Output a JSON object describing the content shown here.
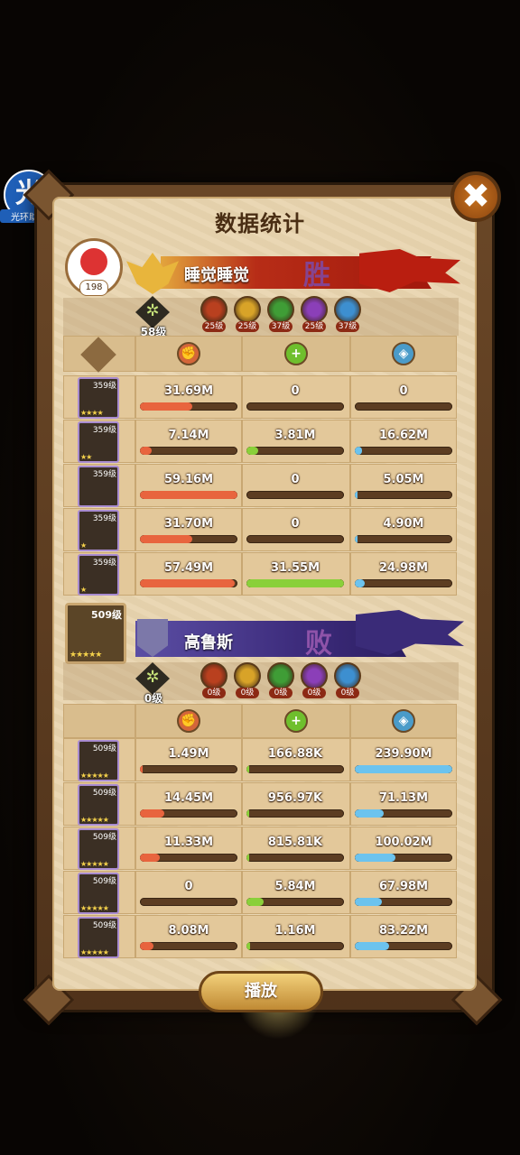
{
  "watermark": {
    "char": "光",
    "caption": "光环助手"
  },
  "title": "数据统计",
  "close_label": "✖",
  "player1": {
    "name": "睡觉睡觉",
    "result": "胜",
    "avatar_level": "198",
    "tree_level": "58级",
    "faction_levels": [
      "25级",
      "25级",
      "37级",
      "25级",
      "37级"
    ],
    "heroes": [
      {
        "level": "359级",
        "stars": "★★★★",
        "damage": "31.69M",
        "healing": "0",
        "shield": "0",
        "damage_pct": 0.54,
        "healing_pct": 0,
        "shield_pct": 0
      },
      {
        "level": "359级",
        "stars": "★★",
        "damage": "7.14M",
        "healing": "3.81M",
        "shield": "16.62M",
        "damage_pct": 0.12,
        "healing_pct": 0.12,
        "shield_pct": 0.07
      },
      {
        "level": "359级",
        "stars": "",
        "damage": "59.16M",
        "healing": "0",
        "shield": "5.05M",
        "damage_pct": 1.0,
        "healing_pct": 0,
        "shield_pct": 0.02
      },
      {
        "level": "359级",
        "stars": "★",
        "damage": "31.70M",
        "healing": "0",
        "shield": "4.90M",
        "damage_pct": 0.54,
        "healing_pct": 0,
        "shield_pct": 0.02
      },
      {
        "level": "359级",
        "stars": "★",
        "damage": "57.49M",
        "healing": "31.55M",
        "shield": "24.98M",
        "damage_pct": 0.97,
        "healing_pct": 1.0,
        "shield_pct": 0.1
      }
    ]
  },
  "player2": {
    "name": "高鲁斯",
    "result": "败",
    "avatar_level": "509级",
    "avatar_stars": "★★★★★",
    "tree_level": "0级",
    "faction_levels": [
      "0级",
      "0级",
      "0级",
      "0级",
      "0级"
    ],
    "heroes": [
      {
        "level": "509级",
        "stars": "★★★★★",
        "damage": "1.49M",
        "healing": "166.88K",
        "shield": "239.90M",
        "damage_pct": 0.03,
        "healing_pct": 0.02,
        "shield_pct": 1.0
      },
      {
        "level": "509级",
        "stars": "★★★★★",
        "damage": "14.45M",
        "healing": "956.97K",
        "shield": "71.13M",
        "damage_pct": 0.25,
        "healing_pct": 0.02,
        "shield_pct": 0.3
      },
      {
        "level": "509级",
        "stars": "★★★★★",
        "damage": "11.33M",
        "healing": "815.81K",
        "shield": "100.02M",
        "damage_pct": 0.2,
        "healing_pct": 0.02,
        "shield_pct": 0.42
      },
      {
        "level": "509级",
        "stars": "★★★★★",
        "damage": "0",
        "healing": "5.84M",
        "shield": "67.98M",
        "damage_pct": 0,
        "healing_pct": 0.18,
        "shield_pct": 0.28
      },
      {
        "level": "509级",
        "stars": "★★★★★",
        "damage": "8.08M",
        "healing": "1.16M",
        "shield": "83.22M",
        "damage_pct": 0.14,
        "healing_pct": 0.04,
        "shield_pct": 0.35
      }
    ]
  },
  "colors": {
    "damage": "#e8643e",
    "healing": "#8ad03a",
    "shield": "#6cc3ee"
  },
  "factions": [
    "#b9401f",
    "#d8a328",
    "#3f9d36",
    "#8b3fb8",
    "#3d8fd0"
  ],
  "play_label": "播放"
}
